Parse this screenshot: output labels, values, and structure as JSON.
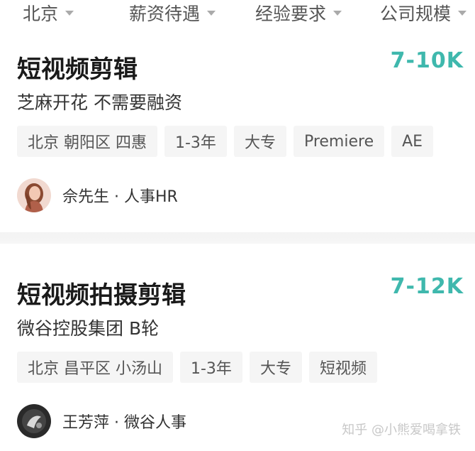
{
  "filters": [
    {
      "label": "北京"
    },
    {
      "label": "薪资待遇"
    },
    {
      "label": "经验要求"
    },
    {
      "label": "公司规模"
    }
  ],
  "jobs": [
    {
      "title": "短视频剪辑",
      "salary": "7-10K",
      "company": "芝麻开花 不需要融资",
      "tags": [
        "北京 朝阳区 四惠",
        "1-3年",
        "大专",
        "Premiere",
        "AE"
      ],
      "recruiter": "佘先生 · 人事HR"
    },
    {
      "title": "短视频拍摄剪辑",
      "salary": "7-12K",
      "company": "微谷控股集团 B轮",
      "tags": [
        "北京 昌平区 小汤山",
        "1-3年",
        "大专",
        "短视频"
      ],
      "recruiter": "王芳萍 · 微谷人事"
    }
  ],
  "watermark": "知乎 @小熊爱喝拿铁",
  "colors": {
    "salary": "#3fb8ad",
    "tag_bg": "#f5f5f5",
    "divider": "#f3f3f3"
  }
}
